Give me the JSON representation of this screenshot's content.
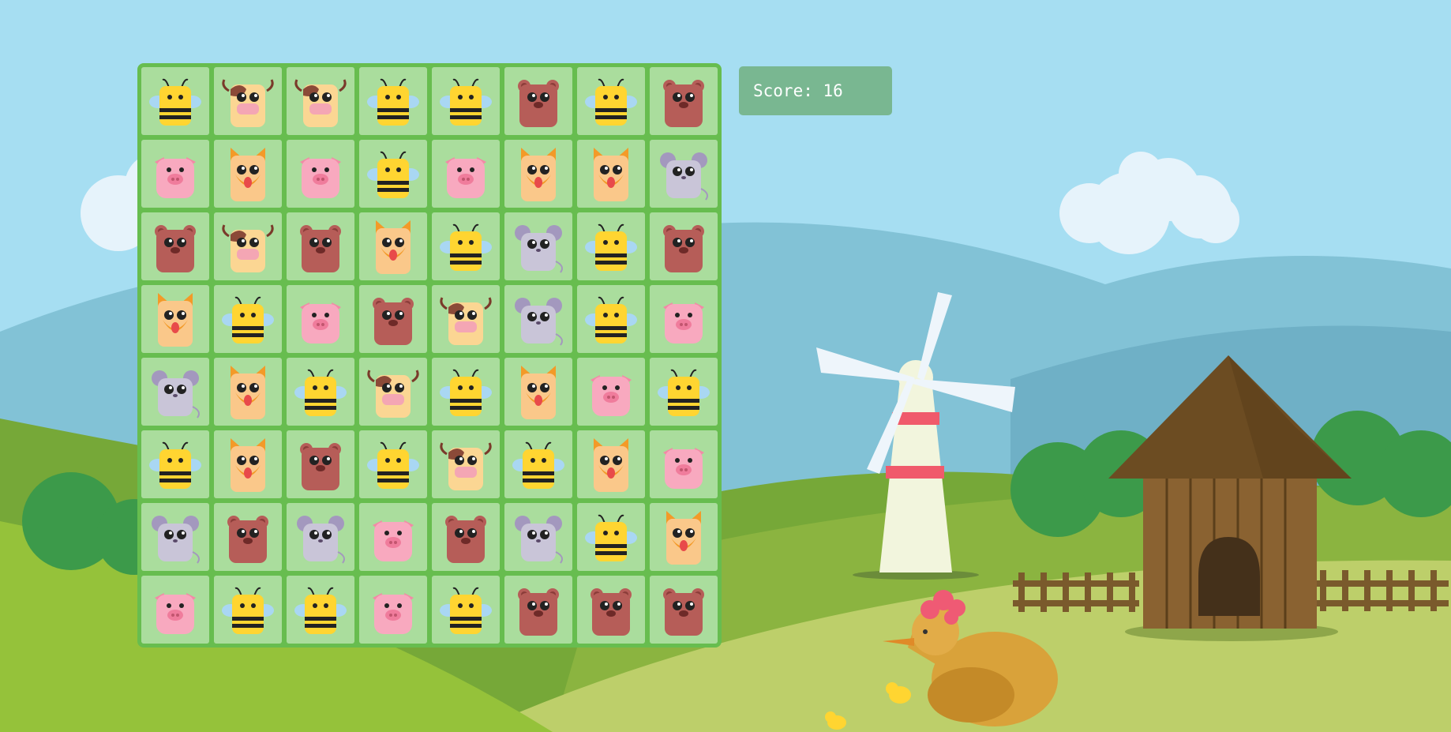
{
  "score": {
    "label": "Score:",
    "value": "16"
  },
  "board": {
    "rows": 8,
    "cols": 8,
    "grid": [
      [
        "bee",
        "cow",
        "cow",
        "bee",
        "bee",
        "bear",
        "bee",
        "bear"
      ],
      [
        "pig",
        "fox",
        "pig",
        "bee",
        "pig",
        "fox",
        "fox",
        "mouse"
      ],
      [
        "bear",
        "cow",
        "bear",
        "fox",
        "bee",
        "mouse",
        "bee",
        "bear"
      ],
      [
        "fox",
        "bee",
        "pig",
        "bear",
        "cow",
        "mouse",
        "bee",
        "pig"
      ],
      [
        "mouse",
        "fox",
        "bee",
        "cow",
        "bee",
        "fox",
        "pig",
        "bee"
      ],
      [
        "bee",
        "fox",
        "bear",
        "bee",
        "cow",
        "bee",
        "fox",
        "pig"
      ],
      [
        "mouse",
        "bear",
        "mouse",
        "pig",
        "bear",
        "mouse",
        "bee",
        "fox"
      ],
      [
        "pig",
        "bee",
        "bee",
        "pig",
        "bee",
        "bear",
        "bear",
        "bear"
      ]
    ]
  },
  "colors": {
    "sky": "#a6def2",
    "board": "#67bd4f",
    "tile": "#c4e7b7",
    "score_box": "#79b791",
    "bee": "#ffd531",
    "cow": "#fbd693",
    "pig": "#f8a9bf",
    "fox": "#fac88a",
    "bear": "#b65d58",
    "mouse": "#c9c5d8"
  },
  "icons": [
    "bee-icon",
    "cow-icon",
    "pig-icon",
    "fox-icon",
    "bear-icon",
    "mouse-icon",
    "windmill",
    "barn",
    "fence",
    "hen",
    "chick",
    "cloud"
  ]
}
